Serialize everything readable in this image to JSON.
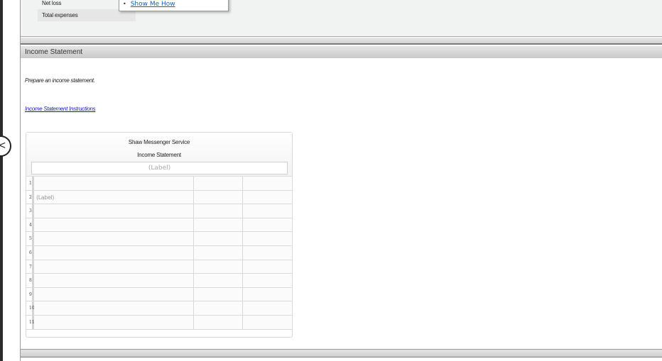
{
  "top_panel": {
    "accounts": [
      {
        "label": "Net loss"
      },
      {
        "label": "Total expenses"
      }
    ],
    "popup": {
      "items": [
        {
          "label": "Show Me How"
        }
      ]
    }
  },
  "collapse_button": {
    "icon": "chevron-left-icon",
    "glyph": "<"
  },
  "section": {
    "title": "Income Statement",
    "instructions": "Prepare an income statement.",
    "instructions_link": "Income Statement Instructions"
  },
  "statement": {
    "company": "Shaw Messenger Service",
    "title": "Income Statement",
    "period_placeholder": "(Label)",
    "rows": [
      {
        "num": "1",
        "label": "",
        "amount1": "",
        "amount2": ""
      },
      {
        "num": "2",
        "label": "(Label)",
        "amount1": "",
        "amount2": ""
      },
      {
        "num": "3",
        "label": "",
        "amount1": "",
        "amount2": ""
      },
      {
        "num": "4",
        "label": "",
        "amount1": "",
        "amount2": ""
      },
      {
        "num": "5",
        "label": "",
        "amount1": "",
        "amount2": ""
      },
      {
        "num": "6",
        "label": "",
        "amount1": "",
        "amount2": ""
      },
      {
        "num": "7",
        "label": "",
        "amount1": "",
        "amount2": ""
      },
      {
        "num": "8",
        "label": "",
        "amount1": "",
        "amount2": ""
      },
      {
        "num": "9",
        "label": "",
        "amount1": "",
        "amount2": ""
      },
      {
        "num": "10",
        "label": "",
        "amount1": "",
        "amount2": ""
      },
      {
        "num": "11",
        "label": "",
        "amount1": "",
        "amount2": ""
      }
    ]
  }
}
